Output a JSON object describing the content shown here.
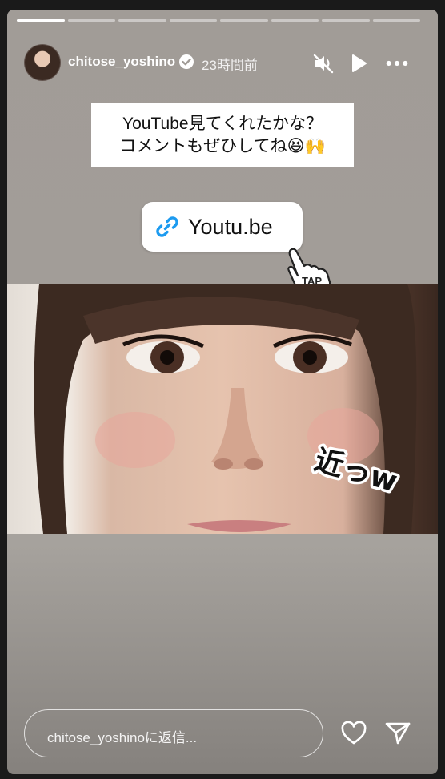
{
  "story": {
    "segments_total": 8,
    "segments_done": 1,
    "username": "chitose_yoshino",
    "time_ago": "23時間前",
    "icons": [
      "mute-icon",
      "play-icon",
      "more-icon",
      "verified-icon"
    ]
  },
  "caption": {
    "line1": "YouTube見てくれたかな？",
    "line2": "コメントもぜひしてね😆🙌"
  },
  "link_sticker": {
    "label": "Youtu.be",
    "icon": "link-icon"
  },
  "tap_sticker": {
    "label": "TAP"
  },
  "photo_sticker": {
    "label": "近っw"
  },
  "reply": {
    "placeholder": "chitose_yoshinoに返信...",
    "icons": [
      "heart-icon",
      "send-icon"
    ]
  },
  "colors": {
    "accent_link": "#1d9bf0",
    "text_light": "#ffffff"
  }
}
